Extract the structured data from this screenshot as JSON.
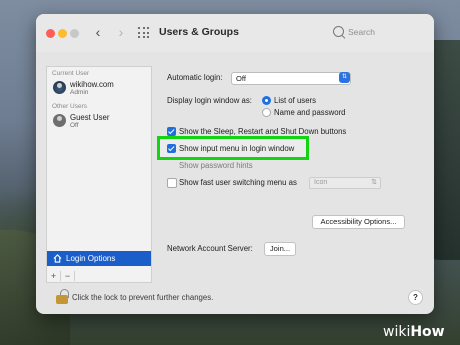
{
  "window": {
    "title": "Users & Groups"
  },
  "search": {
    "placeholder": "Search"
  },
  "sidebar": {
    "current_user_header": "Current User",
    "current_user": {
      "name": "wikihow.com",
      "role": "Admin"
    },
    "other_users_header": "Other Users",
    "other_user": {
      "name": "Guest User",
      "role": "Off"
    },
    "login_options_label": "Login Options",
    "add_label": "+",
    "remove_label": "−"
  },
  "settings": {
    "automatic_login_label": "Automatic login:",
    "automatic_login_value": "Off",
    "display_login_label": "Display login window as:",
    "display_options": [
      "List of users",
      "Name and password"
    ],
    "display_selected": "List of users",
    "show_sleep_label": "Show the Sleep, Restart and Shut Down buttons",
    "show_sleep_checked": true,
    "show_input_menu_label": "Show input menu in login window",
    "show_input_menu_checked": true,
    "show_password_hints_label": "Show password hints",
    "show_fast_switching_label": "Show fast user switching menu as",
    "fast_switching_value": "Icon",
    "accessibility_button": "Accessibility Options...",
    "network_server_label": "Network Account Server:",
    "join_button": "Join..."
  },
  "footer": {
    "lock_text": "Click the lock to prevent further changes.",
    "help_label": "?"
  },
  "watermark": {
    "wiki": "wiki",
    "how": "How"
  },
  "colors": {
    "accent": "#1f6fe0",
    "sidebar_selected": "#1a5fc9",
    "highlight_box": "#12d412"
  }
}
